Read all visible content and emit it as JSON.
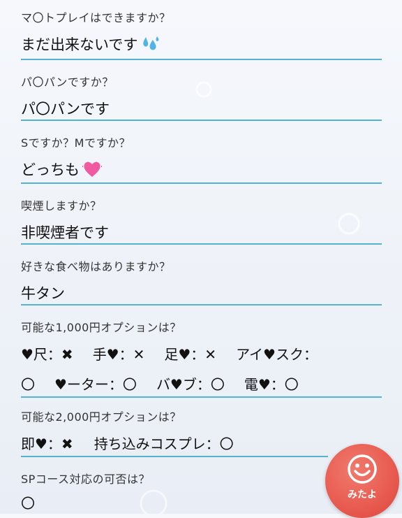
{
  "items": [
    {
      "question": "マ〇トプレイはできますか？",
      "answer": "まだ出来ないです",
      "answer_emoji": "sweat-droplets-icon"
    },
    {
      "question": "パ〇パンですか？",
      "answer": "パ〇パンです"
    },
    {
      "question": "Sですか？Mですか？",
      "answer": "どっちも",
      "answer_emoji": "heart-icon"
    },
    {
      "question": "喫煙しますか？",
      "answer": "非喫煙者です"
    },
    {
      "question": "好きな食べ物はありますか？",
      "answer": "牛タン"
    }
  ],
  "options1000": {
    "question": "可能な1,000円オプションは？",
    "line1": [
      "♥尺：✖",
      "手♥：✕",
      "足♥：✕",
      "アイ♥スク："
    ],
    "line2": [
      "〇",
      "♥ーター：〇",
      "バ♥ブ：〇",
      "電♥：〇"
    ]
  },
  "options2000": {
    "question": "可能な2,000円オプションは？",
    "line1": [
      "即♥：✖",
      "持ち込みコスプレ：〇"
    ]
  },
  "sp": {
    "question": "SPコース対応の可否は？",
    "answer": "〇"
  },
  "fab": {
    "label": "みたよ",
    "icon": "smiley-face-icon"
  },
  "colors": {
    "divider": "#54b3d1",
    "fab": "#e85a4f"
  }
}
